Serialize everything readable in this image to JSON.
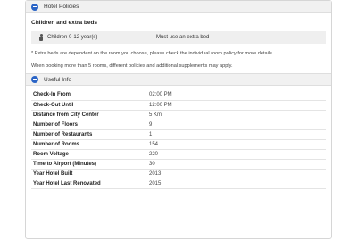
{
  "hotel_policies": {
    "title": "Hotel Policies",
    "subheading": "Children and extra beds",
    "child_row": {
      "label": "Children 0-12 year(s)",
      "value": "Must use an extra bed"
    },
    "note1": "* Extra beds are dependent on the room you choose, please check the individual room policy for more details.",
    "note2": "When booking more than 5 rooms, different policies and additional supplements may apply."
  },
  "useful_info": {
    "title": "Useful Info",
    "rows": [
      {
        "label": "Check-In From",
        "value": "02:00 PM"
      },
      {
        "label": "Check-Out Until",
        "value": "12:00 PM"
      },
      {
        "label": "Distance from City Center",
        "value": "5 Km"
      },
      {
        "label": "Number of Floors",
        "value": "9"
      },
      {
        "label": "Number of Restaurants",
        "value": "1"
      },
      {
        "label": "Number of Rooms",
        "value": "154"
      },
      {
        "label": "Room Voltage",
        "value": "220"
      },
      {
        "label": "Time to Airport (Minutes)",
        "value": "30"
      },
      {
        "label": "Year Hotel Built",
        "value": "2013"
      },
      {
        "label": "Year Hotel Last Renovated",
        "value": "2015"
      }
    ]
  },
  "icons": {
    "section_toggle": "minus-circle-icon",
    "child": "child-icon"
  },
  "colors": {
    "toggle": "#2a64c6",
    "header_bg": "#f1f1f1",
    "row_bg": "#efefef"
  }
}
